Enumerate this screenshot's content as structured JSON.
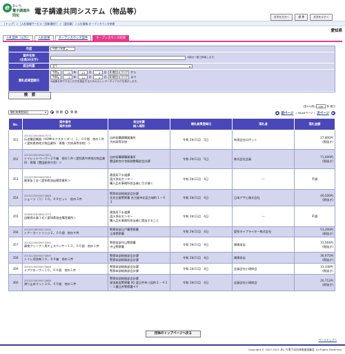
{
  "header": {
    "logo_line1": "あいち",
    "logo_line2": "電子調達共同化",
    "logo_letter": "e",
    "title": "電子調達共同システム（物品等）",
    "btn_font_large": "文字を大きく",
    "btn_font_std": "標 準",
    "btn_font_small": "文字を小さく"
  },
  "breadcrumb": "［トップ］＞［入札情報サービス（団体選択）］＞［愛知県］＞入札情報:オープンカウンタ結果",
  "org": "愛知県",
  "tabs": [
    "入札案件（公告）",
    "入札結果",
    "オープンカウンタ案件",
    "オープンカウンタ結果"
  ],
  "form": {
    "year_label": "年度",
    "year_value": "令和 2年度",
    "name_label": "案件名称",
    "name_sub": "(全角50文字)",
    "name_hint": "※部分一致で検索します。",
    "agency_label": "発注所属",
    "agency_value": "全て",
    "date_label": "開札結果登録日",
    "from_era": "令和",
    "from_y": "2",
    "from_m": "11",
    "from_d": "4",
    "to_era": "令和",
    "to_y": "2",
    "to_m": "11",
    "to_d": "4",
    "unit_year": "年",
    "unit_month": "月",
    "unit_day": "日",
    "cal_btn": "本 曜日",
    "clear_btn": "クリア",
    "from_suffix": "から",
    "to_suffix": "まで",
    "cal_hint": "※画像を押下すると日付を指定するためのカレンダーダイアログを表示します。"
  },
  "search_btn": "検　索",
  "sort": {
    "select_value": "開札結果登録日",
    "asc": "昇 順",
    "desc": "降 順"
  },
  "pager": {
    "count": "(全473件)",
    "perpage": "10",
    "perpage_suffix": "件 表示",
    "prev": "前ページ",
    "page_info": "( 36/48ページ )",
    "next": "次ページ"
  },
  "table": {
    "headers": {
      "no": "No.",
      "case": "案件番号\n案件名称",
      "agency": "発注所属\n納入場所",
      "date": "開札結果登録日",
      "winner": "落札者",
      "amount": "落札金額"
    },
    "rows": [
      {
        "no": "351",
        "id": "20102230000047570",
        "name": "伝送電話機器（HOMIエクステンダー）１，００個　他の１件＜愛知県南地方物品業所：現場（大府高等学校）＞",
        "agency": "自府発購課購買業所\n大府高等学校",
        "date": "令和 2年11月　5日",
        "winner": "有限会社ロボット",
        "amount": "27,800円",
        "tax": "(税抜き)"
      },
      {
        "no": "352",
        "id": "20102230000047822",
        "name": "トイレットペーパー２０箱　他の１件＜愛知県中央地方物品業所：現場（豊田総合庁舎）＞",
        "agency": "自府発購課購買業所\n豊田総合庁舎総務整備部会計課",
        "date": "令和 2年11月　5日",
        "winner": "株式会社会員",
        "amount": "71,600円",
        "tax": "(税抜き)"
      },
      {
        "no": "353",
        "id": "20102230000047859",
        "name": "廃車缶１台＜愛知県加出備営業所＞",
        "agency": "建設局下水道課\n渡川浄化センター\n購入品を事務所担当者に引き継ぐ",
        "date": "令和 2年11月　4日",
        "winner": "---",
        "amount": "不調",
        "tax": ""
      },
      {
        "no": "354",
        "id": "20102230000073886",
        "name": "シェーツ（１）１０，００セット　他の３件",
        "agency": "警察本部総務部会計課\n北名古屋警察署 名古屋市北区古城町１－６３",
        "date": "令和 2年11月　4日",
        "winner": "日本アサヒ株式会社",
        "amount": "40,500円",
        "tax": "(税抜き)"
      },
      {
        "no": "355",
        "id": "20092023000047075",
        "name": "自動採水器１式＜愛知県加出備営業所＞",
        "agency": "建設局下水道課\n渡川浄化センター\n購入品を事務所担当者に提出すること",
        "date": "令和 2年11月　4日",
        "winner": "---",
        "amount": "不調",
        "tax": ""
      },
      {
        "no": "356",
        "id": "20102230000074202",
        "name": "トナーカートリッジ２，００個　他の４件",
        "agency": "警察本部江戸署警察署\n江南警察署",
        "date": "令和 2年11月　4日",
        "winner": "愛知タイプライター株式会社",
        "amount": "53,200円",
        "tax": "(税抜き)"
      },
      {
        "no": "357",
        "id": "20102230000074340",
        "name": "康食クリーナー用チェスペンサー１３，００個　他の１件",
        "agency": "警察本部守山警察署\n守山警察署",
        "date": "令和 2年11月　4日",
        "winner": "康康本店",
        "amount": "31,564円",
        "tax": "(税抜き)"
      },
      {
        "no": "358",
        "id": "20102230000073669",
        "name": "トイレ用洗剤１０，００箱　他の１件",
        "agency": "警察本部総務部会計課\n警察本部総務部会計課",
        "date": "令和 2年11月　4日",
        "winner": "康康本店",
        "amount": "36,975円",
        "tax": "(税抜き)"
      },
      {
        "no": "359",
        "id": "20102230000073668",
        "name": "ドアクローザー１０，００個　他の１件",
        "agency": "警察本部総務部会計課\n警察本部総務部会計課",
        "date": "令和 2年11月　4日",
        "winner": "会員会社小理商会",
        "amount": "33,338円",
        "tax": "(税抜き)"
      },
      {
        "no": "360",
        "id": "20102230000073866",
        "name": "港り止めマット２８，００枚　他の１件",
        "agency": "警察本部総務部会計課\n尾張星庭警察署 (K) 愛日井市八田町２－４３－１番日井警察署４Ｆ",
        "date": "令和 2年11月　4日",
        "winner": "会員会社小理商会",
        "amount": "26,712円",
        "tax": "(税抜き)"
      }
    ]
  },
  "bottom_btn": "団体のトップページへ戻る",
  "page_top": "ページトップへ",
  "footer": "Copyright © 2007-2021 あいち電子自治体推進協議会. All Rights Reserved."
}
